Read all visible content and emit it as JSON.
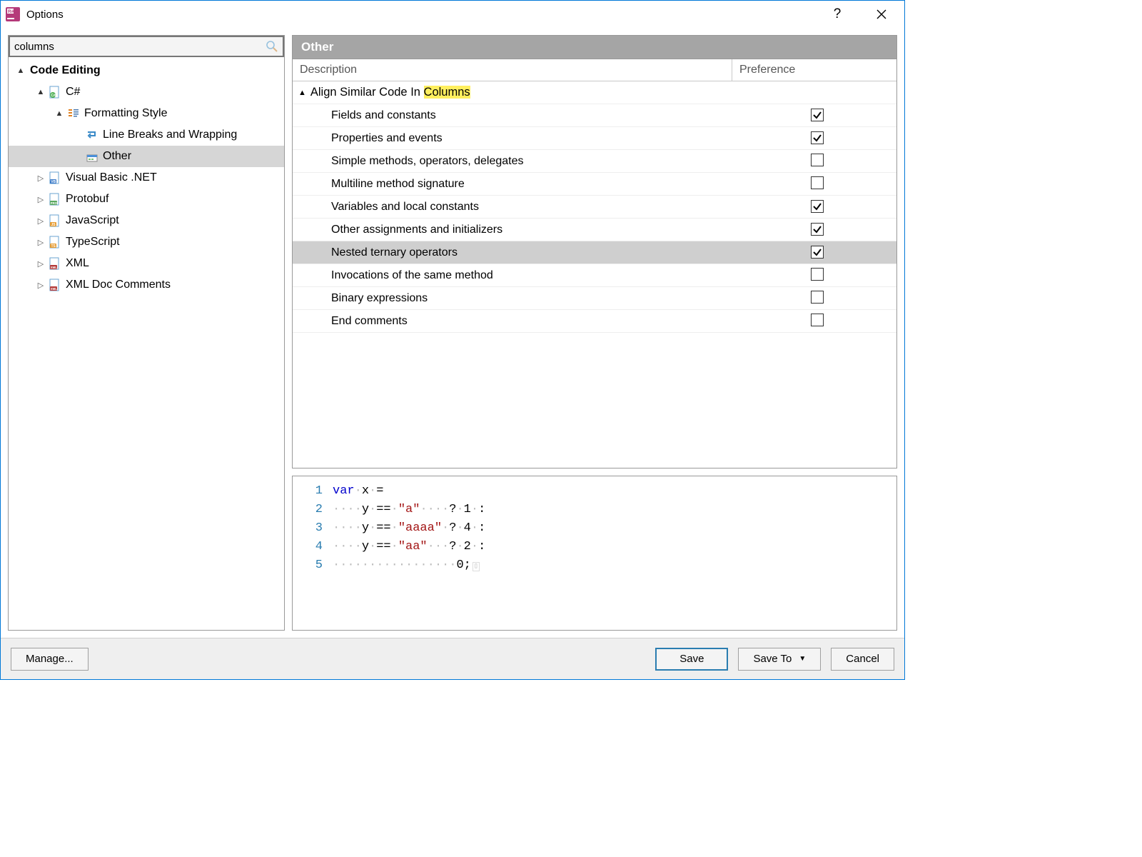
{
  "window": {
    "title": "Options"
  },
  "search": {
    "value": "columns"
  },
  "tree": {
    "root": "Code Editing",
    "csharp": "C#",
    "formatting": "Formatting Style",
    "lineBreaks": "Line Breaks and Wrapping",
    "other": "Other",
    "vb": "Visual Basic .NET",
    "protobuf": "Protobuf",
    "js": "JavaScript",
    "ts": "TypeScript",
    "xml": "XML",
    "xmldoc": "XML Doc Comments"
  },
  "panel": {
    "title": "Other",
    "colDescription": "Description",
    "colPreference": "Preference",
    "groupPrefix": "Align Similar Code In ",
    "groupHighlight": "Columns",
    "items": [
      {
        "label": "Fields and constants",
        "checked": true,
        "selected": false
      },
      {
        "label": "Properties and events",
        "checked": true,
        "selected": false
      },
      {
        "label": "Simple methods, operators, delegates",
        "checked": false,
        "selected": false
      },
      {
        "label": "Multiline method signature",
        "checked": false,
        "selected": false
      },
      {
        "label": "Variables and local constants",
        "checked": true,
        "selected": false
      },
      {
        "label": "Other assignments and initializers",
        "checked": true,
        "selected": false
      },
      {
        "label": "Nested ternary operators",
        "checked": true,
        "selected": true
      },
      {
        "label": "Invocations of the same method",
        "checked": false,
        "selected": false
      },
      {
        "label": "Binary expressions",
        "checked": false,
        "selected": false
      },
      {
        "label": "End comments",
        "checked": false,
        "selected": false
      }
    ]
  },
  "preview": {
    "lines": [
      {
        "n": "1",
        "html": "<span class='kw'>var</span><span class='ws'>·</span>x<span class='ws'>·</span>="
      },
      {
        "n": "2",
        "html": "<span class='ws'>····</span>y<span class='ws'>·</span>==<span class='ws'>·</span><span class='str'>\"a\"</span><span class='ws'>····</span>?<span class='ws'>·</span><span class='num'>1</span><span class='ws'>·</span>:"
      },
      {
        "n": "3",
        "html": "<span class='ws'>····</span>y<span class='ws'>·</span>==<span class='ws'>·</span><span class='str'>\"aaaa\"</span><span class='ws'>·</span>?<span class='ws'>·</span><span class='num'>4</span><span class='ws'>·</span>:"
      },
      {
        "n": "4",
        "html": "<span class='ws'>····</span>y<span class='ws'>·</span>==<span class='ws'>·</span><span class='str'>\"aa\"</span><span class='ws'>···</span>?<span class='ws'>·</span><span class='num'>2</span><span class='ws'>·</span>:"
      },
      {
        "n": "5",
        "html": "<span class='ws'>·················</span><span class='num'>0</span>;<span class='eol'>▯</span>"
      }
    ]
  },
  "footer": {
    "manage": "Manage...",
    "save": "Save",
    "saveTo": "Save To",
    "cancel": "Cancel"
  }
}
